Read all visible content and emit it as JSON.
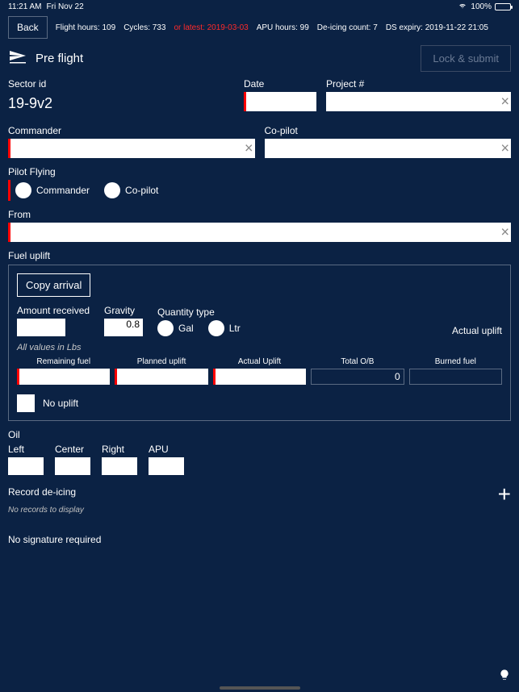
{
  "status": {
    "time": "11:21 AM",
    "date": "Fri Nov 22",
    "battery_pct": "100%"
  },
  "topbar": {
    "back": "Back",
    "flight_hours": "Flight hours: 109",
    "cycles": "Cycles: 733",
    "or_latest": "or latest: 2019-03-03",
    "apu_hours": "APU hours: 99",
    "deicing_count": "De-icing count: 7",
    "ds_expiry": "DS expiry: 2019-11-22 21:05"
  },
  "header": {
    "title": "Pre flight",
    "lock_submit": "Lock & submit"
  },
  "sector": {
    "label": "Sector id",
    "value": "19-9v2"
  },
  "date": {
    "label": "Date",
    "value": ""
  },
  "project": {
    "label": "Project #",
    "value": ""
  },
  "commander": {
    "label": "Commander",
    "value": ""
  },
  "copilot": {
    "label": "Co-pilot",
    "value": ""
  },
  "pilot_flying": {
    "label": "Pilot Flying",
    "opt_commander": "Commander",
    "opt_copilot": "Co-pilot"
  },
  "from": {
    "label": "From",
    "value": ""
  },
  "fuel": {
    "section_label": "Fuel uplift",
    "copy_arrival": "Copy arrival",
    "amount_received": {
      "label": "Amount received",
      "value": ""
    },
    "gravity": {
      "label": "Gravity",
      "value": "0.8"
    },
    "quantity_type": {
      "label": "Quantity type",
      "gal": "Gal",
      "ltr": "Ltr"
    },
    "actual_uplift_label": "Actual uplift",
    "note": "All values in Lbs",
    "remaining": {
      "label": "Remaining fuel",
      "value": ""
    },
    "planned_uplift": {
      "label": "Planned uplift",
      "value": ""
    },
    "actual_uplift": {
      "label": "Actual Uplift",
      "value": ""
    },
    "total_ob": {
      "label": "Total O/B",
      "value": "0"
    },
    "burned": {
      "label": "Burned fuel",
      "value": ""
    },
    "no_uplift": "No uplift"
  },
  "oil": {
    "label": "Oil",
    "left": "Left",
    "center": "Center",
    "right": "Right",
    "apu": "APU"
  },
  "deicing": {
    "label": "Record de-icing",
    "empty": "No records to display"
  },
  "signature": "No signature required"
}
